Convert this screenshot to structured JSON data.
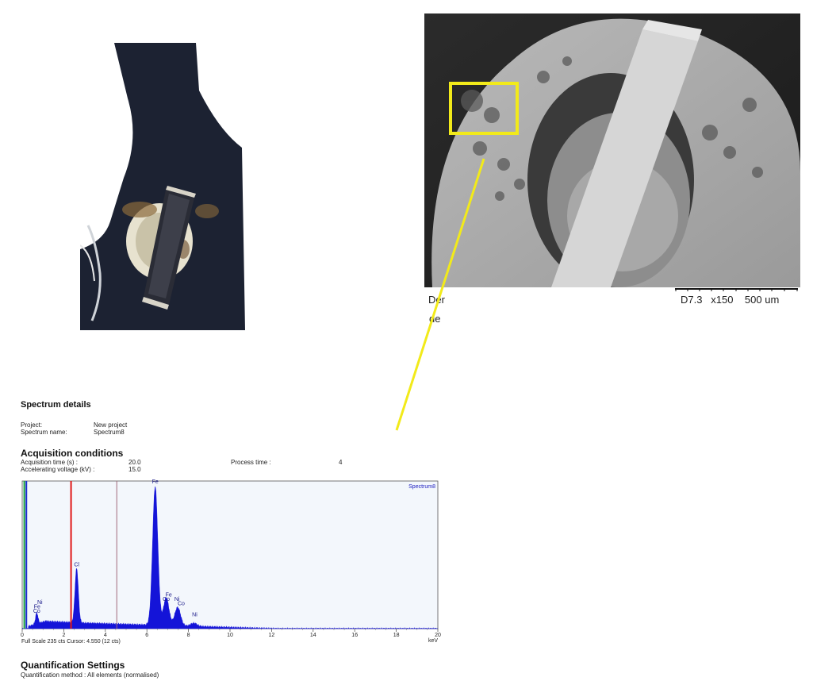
{
  "sem_image": {
    "label_line1": "Der",
    "label_line2": "de",
    "info": "D7.3   x150    500 um",
    "highlight_color": "#f2ea1a"
  },
  "spectrum_details": {
    "title": "Spectrum details",
    "project_label": "Project:",
    "project_value": "New project",
    "spectrum_name_label": "Spectrum name:",
    "spectrum_name_value": "Spectrum8"
  },
  "acquisition": {
    "title": "Acquisition conditions",
    "time_label": "Acquisition time (s) :",
    "time_value": "20.0",
    "voltage_label": "Accelerating voltage (kV) :",
    "voltage_value": "15.0",
    "process_label": "Process time :",
    "process_value": "4"
  },
  "quantification": {
    "title": "Quantification Settings",
    "method": "Quantification method :    All elements (normalised)"
  },
  "chart_data": {
    "type": "area",
    "series_name": "Spectrum8",
    "x_unit": "keV",
    "xlim": [
      0,
      20
    ],
    "x_ticks": [
      "0",
      "2",
      "4",
      "6",
      "8",
      "10",
      "12",
      "14",
      "16",
      "18",
      "20"
    ],
    "full_scale": "Full Scale 235 cts Cursor: 4.550  (12 cts)",
    "cursor_lines": [
      {
        "x": 0.1,
        "color": "#1a9e3a"
      },
      {
        "x": 0.2,
        "color": "#1a2ad0"
      },
      {
        "x": 2.35,
        "color": "#e01818"
      },
      {
        "x": 4.55,
        "color": "#a06a7a"
      }
    ],
    "peaks": [
      {
        "keV": 0.7,
        "counts": 18
      },
      {
        "keV": 2.62,
        "counts": 88
      },
      {
        "keV": 6.4,
        "counts": 225
      },
      {
        "keV": 6.93,
        "counts": 45
      },
      {
        "keV": 7.48,
        "counts": 30
      },
      {
        "keV": 8.26,
        "counts": 5
      }
    ],
    "peak_labels": [
      {
        "text": "Ni",
        "keV": 0.85,
        "counts": 40
      },
      {
        "text": "Fe",
        "keV": 0.72,
        "counts": 33
      },
      {
        "text": "Co",
        "keV": 0.7,
        "counts": 26
      },
      {
        "text": "Cl",
        "keV": 2.62,
        "counts": 101
      },
      {
        "text": "Fe",
        "keV": 6.4,
        "counts": 236
      },
      {
        "text": "Fe",
        "keV": 7.05,
        "counts": 52
      },
      {
        "text": "Co",
        "keV": 6.93,
        "counts": 45
      },
      {
        "text": "Ni",
        "keV": 7.45,
        "counts": 45
      },
      {
        "text": "Co",
        "keV": 7.65,
        "counts": 38
      },
      {
        "text": "Ni",
        "keV": 8.3,
        "counts": 20
      }
    ],
    "ylim": [
      0,
      240
    ],
    "fill_color": "#1414d8",
    "background": "#f3f7fc"
  }
}
